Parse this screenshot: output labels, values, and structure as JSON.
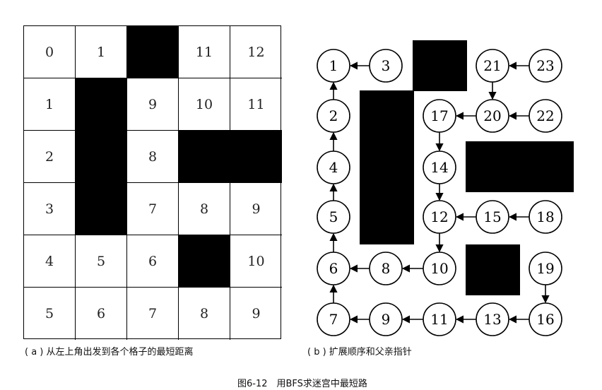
{
  "panel_a": {
    "rows": [
      [
        "0",
        "1",
        "",
        "11",
        "12"
      ],
      [
        "1",
        "",
        "9",
        "10",
        "11"
      ],
      [
        "2",
        "",
        "8",
        "",
        ""
      ],
      [
        "3",
        "",
        "7",
        "8",
        "9"
      ],
      [
        "4",
        "5",
        "6",
        "",
        "10"
      ],
      [
        "5",
        "6",
        "7",
        "8",
        "9"
      ]
    ],
    "walls": [
      [
        0,
        2
      ],
      [
        1,
        1
      ],
      [
        2,
        1
      ],
      [
        3,
        1
      ],
      [
        2,
        3
      ],
      [
        2,
        4
      ],
      [
        4,
        3
      ]
    ],
    "caption": "( a ) 从左上角出发到各个格子的最短距离"
  },
  "panel_b": {
    "nodes": [
      {
        "id": "n1",
        "label": "1"
      },
      {
        "id": "n3",
        "label": "3"
      },
      {
        "id": "n21",
        "label": "21"
      },
      {
        "id": "n23",
        "label": "23"
      },
      {
        "id": "n2",
        "label": "2"
      },
      {
        "id": "n17",
        "label": "17"
      },
      {
        "id": "n20",
        "label": "20"
      },
      {
        "id": "n22",
        "label": "22"
      },
      {
        "id": "n4",
        "label": "4"
      },
      {
        "id": "n14",
        "label": "14"
      },
      {
        "id": "n5",
        "label": "5"
      },
      {
        "id": "n12",
        "label": "12"
      },
      {
        "id": "n15",
        "label": "15"
      },
      {
        "id": "n18",
        "label": "18"
      },
      {
        "id": "n6",
        "label": "6"
      },
      {
        "id": "n8",
        "label": "8"
      },
      {
        "id": "n10",
        "label": "10"
      },
      {
        "id": "n19",
        "label": "19"
      },
      {
        "id": "n7",
        "label": "7"
      },
      {
        "id": "n9",
        "label": "9"
      },
      {
        "id": "n11",
        "label": "11"
      },
      {
        "id": "n13",
        "label": "13"
      },
      {
        "id": "n16",
        "label": "16"
      }
    ],
    "edges": [
      [
        "n3",
        "n1"
      ],
      [
        "n23",
        "n21"
      ],
      [
        "n21",
        "n20"
      ],
      [
        "n22",
        "n20"
      ],
      [
        "n20",
        "n17"
      ],
      [
        "n2",
        "n1"
      ],
      [
        "n4",
        "n2"
      ],
      [
        "n5",
        "n4"
      ],
      [
        "n6",
        "n5"
      ],
      [
        "n7",
        "n6"
      ],
      [
        "n17",
        "n14"
      ],
      [
        "n14",
        "n12"
      ],
      [
        "n12",
        "n10"
      ],
      [
        "n15",
        "n12"
      ],
      [
        "n18",
        "n15"
      ],
      [
        "n10",
        "n8"
      ],
      [
        "n8",
        "n6"
      ],
      [
        "n19",
        "n16"
      ],
      [
        "n9",
        "n7"
      ],
      [
        "n11",
        "n9"
      ],
      [
        "n13",
        "n11"
      ],
      [
        "n16",
        "n13"
      ]
    ],
    "caption": "( b ) 扩展顺序和父亲指针"
  },
  "figure_caption": "图6-12　用BFS求迷宫中最短路"
}
